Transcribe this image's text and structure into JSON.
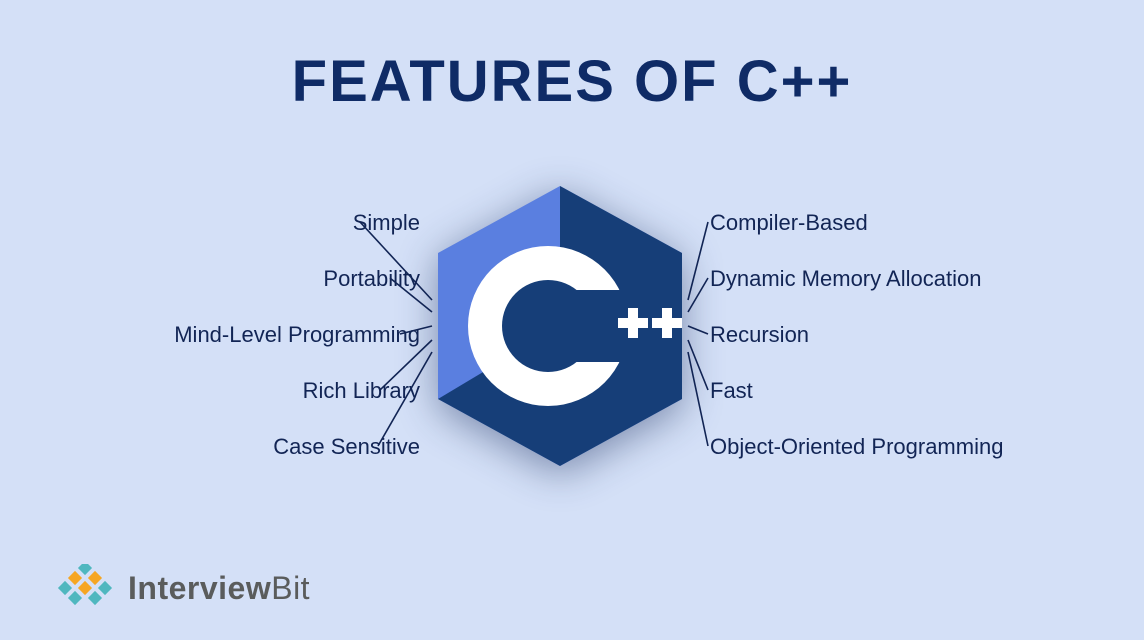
{
  "title": "FEATURES OF C++",
  "center_label": "++",
  "left_features": [
    "Simple",
    "Portability",
    "Mind-Level Programming",
    "Rich Library",
    "Case Sensitive"
  ],
  "right_features": [
    "Compiler-Based",
    "Dynamic Memory Allocation",
    "Recursion",
    "Fast",
    "Object-Oriented Programming"
  ],
  "brand": {
    "bold_part": "Interview",
    "normal_part": "Bit"
  },
  "colors": {
    "hex_light": "#5a7fe0",
    "hex_dark": "#163e78",
    "c_white": "#ffffff",
    "line": "#122555"
  }
}
